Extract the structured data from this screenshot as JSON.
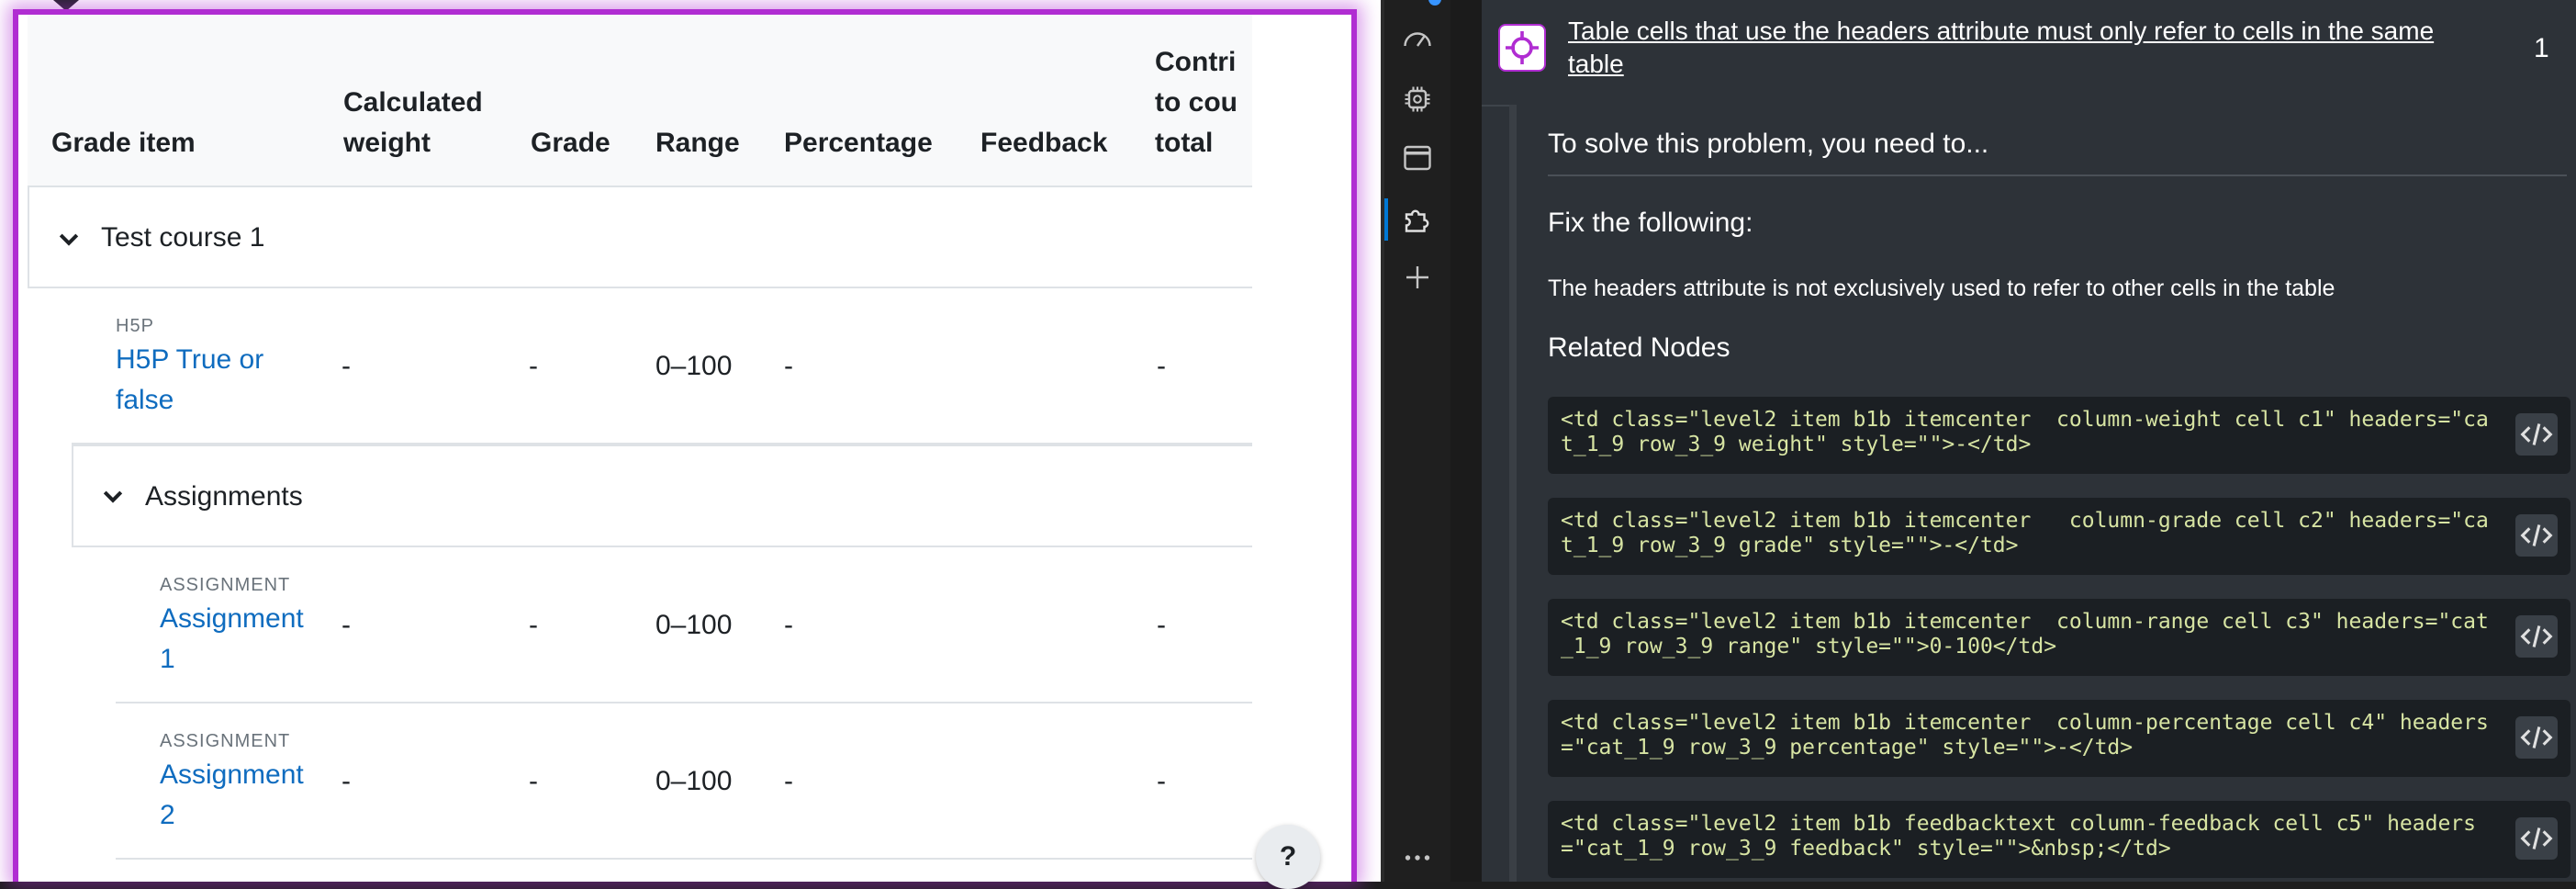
{
  "table": {
    "headers": {
      "grade_item": "Grade item",
      "calc_weight_l1": "Calculated",
      "calc_weight_l2": "weight",
      "grade": "Grade",
      "range": "Range",
      "percentage": "Percentage",
      "feedback": "Feedback",
      "contrib_l1": "Contri",
      "contrib_l2": "to cou",
      "contrib_l3": "total"
    },
    "category_course": "Test course 1",
    "category_assignments": "Assignments",
    "items": [
      {
        "type": "H5P",
        "name_l1": "H5P True or",
        "name_l2": "false",
        "weight": "-",
        "grade": "-",
        "range": "0–100",
        "percentage": "-",
        "contrib": "-"
      },
      {
        "type": "ASSIGNMENT",
        "name_l1": "Assignment",
        "name_l2": "1",
        "weight": "-",
        "grade": "-",
        "range": "0–100",
        "percentage": "-",
        "contrib": "-"
      },
      {
        "type": "ASSIGNMENT",
        "name_l1": "Assignment",
        "name_l2": "2",
        "weight": "-",
        "grade": "-",
        "range": "0–100",
        "percentage": "-",
        "contrib": "-"
      }
    ],
    "help_label": "?"
  },
  "activity_bar": {
    "icons": [
      "performance-icon",
      "memory-icon",
      "application-icon",
      "extension-icon",
      "add-icon",
      "more-icon"
    ],
    "more_label": "..."
  },
  "issue": {
    "title": "Table cells that use the headers attribute must only refer to cells in the same table",
    "count": "1",
    "solve_text": "To solve this problem, you need to...",
    "fix_text": "Fix the following:",
    "fix_detail": "The headers attribute is not exclusively used to refer to other cells in the table",
    "related_label": "Related Nodes",
    "nodes": [
      "<td class=\"level2 item b1b itemcenter  column-weight cell c1\" headers=\"cat_1_9 row_3_9 weight\" style=\"\">-</td>",
      "<td class=\"level2 item b1b itemcenter   column-grade cell c2\" headers=\"cat_1_9 row_3_9 grade\" style=\"\">-</td>",
      "<td class=\"level2 item b1b itemcenter  column-range cell c3\" headers=\"cat_1_9 row_3_9 range\" style=\"\">0-100</td>",
      "<td class=\"level2 item b1b itemcenter  column-percentage cell c4\" headers=\"cat_1_9 row_3_9 percentage\" style=\"\">-</td>",
      "<td class=\"level2 item b1b feedbacktext column-feedback cell c5\" headers=\"cat_1_9 row_3_9 feedback\" style=\"\">&nbsp;</td>"
    ]
  },
  "colors": {
    "highlight": "#b02dd2",
    "link": "#0f6cbf",
    "panel_bg": "#2d3238",
    "code_bg": "#1b1f23"
  }
}
